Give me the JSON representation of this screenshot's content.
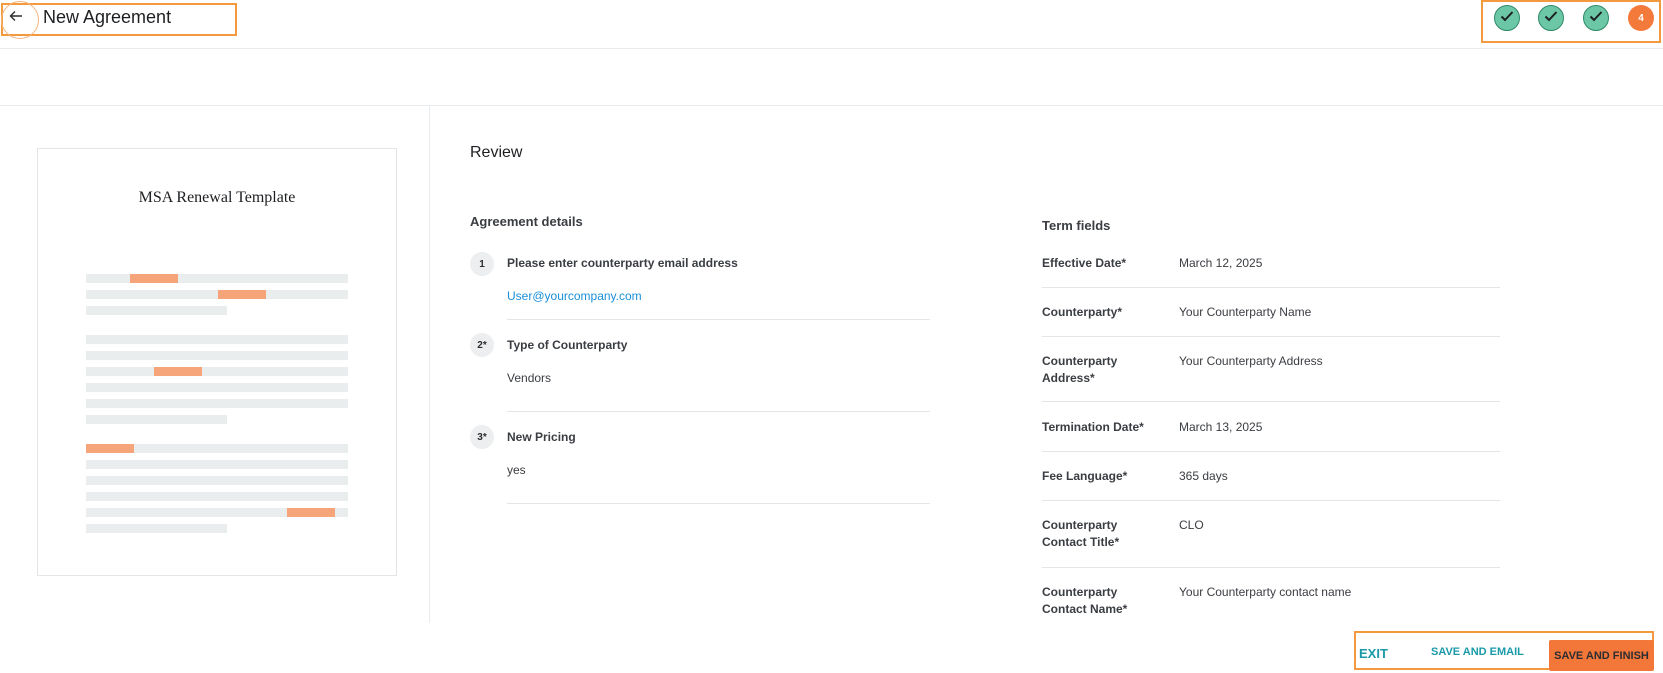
{
  "header": {
    "title": "New Agreement",
    "back_icon": "arrow-left-icon",
    "steps": [
      {
        "state": "done",
        "icon": "check-icon"
      },
      {
        "state": "done",
        "icon": "check-icon"
      },
      {
        "state": "done",
        "icon": "check-icon"
      },
      {
        "state": "current",
        "label": "4"
      }
    ]
  },
  "preview": {
    "doc_title": "MSA Renewal Template"
  },
  "review": {
    "title": "Review",
    "agreement_details": {
      "heading": "Agreement details",
      "questions": [
        {
          "number": "1",
          "label": "Please enter counterparty email address",
          "value": "User@yourcompany.com"
        },
        {
          "number": "2*",
          "label": "Type of Counterparty",
          "value": "Vendors"
        },
        {
          "number": "3*",
          "label": "New Pricing",
          "value": "yes"
        }
      ]
    },
    "term_fields": {
      "heading": "Term fields",
      "fields": [
        {
          "label": "Effective Date*",
          "value": "March 12, 2025"
        },
        {
          "label": "Counterparty*",
          "value": "Your Counterparty Name"
        },
        {
          "label": "Counterparty Address*",
          "value": "Your Counterparty Address"
        },
        {
          "label": "Termination Date*",
          "value": "March 13, 2025"
        },
        {
          "label": "Fee Language*",
          "value": "365 days"
        },
        {
          "label": "Counterparty Contact Title*",
          "value": "CLO"
        },
        {
          "label": "Counterparty Contact Name*",
          "value": "Your Counterparty contact name"
        }
      ]
    }
  },
  "footer": {
    "exit_label": "EXIT",
    "save_email_label": "SAVE AND EMAIL",
    "save_finish_label": "SAVE AND FINISH"
  },
  "colors": {
    "accent_orange": "#f4773a",
    "step_done": "#6cc7a6",
    "link_teal": "#1a9aa8",
    "link_blue": "#1a8fd8"
  }
}
